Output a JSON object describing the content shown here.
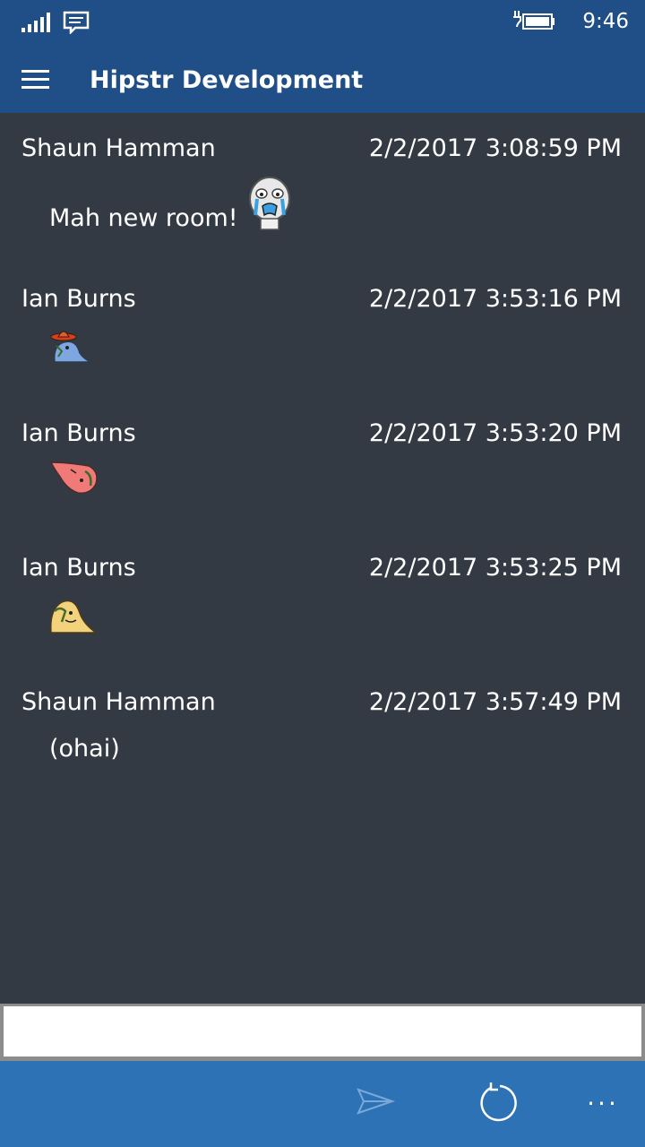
{
  "status_bar": {
    "time": "9:46",
    "icons": [
      "signal-icon",
      "message-icon",
      "battery-charging-icon"
    ]
  },
  "app_bar": {
    "title": "Hipstr Development",
    "menu_icon": "hamburger-icon"
  },
  "messages": [
    {
      "sender": "Shaun Hamman",
      "timestamp": "2/2/2017 3:08:59 PM",
      "text": "Mah new room!",
      "emoticon": "crying-face-emoticon"
    },
    {
      "sender": "Ian Burns",
      "timestamp": "2/2/2017 3:53:16 PM",
      "text": "",
      "emoticon": "sombrero-emoticon"
    },
    {
      "sender": "Ian Burns",
      "timestamp": "2/2/2017 3:53:20 PM",
      "text": "",
      "emoticon": "red-blob-emoticon"
    },
    {
      "sender": "Ian Burns",
      "timestamp": "2/2/2017 3:53:25 PM",
      "text": "",
      "emoticon": "yellow-blob-emoticon"
    },
    {
      "sender": "Shaun Hamman",
      "timestamp": "2/2/2017 3:57:49 PM",
      "text": "(ohai)",
      "emoticon": ""
    }
  ],
  "composer": {
    "value": "",
    "placeholder": ""
  },
  "command_bar": {
    "send_icon": "send-icon",
    "refresh_icon": "refresh-icon",
    "more_label": "..."
  },
  "colors": {
    "header": "#1f4f86",
    "background": "#343a44",
    "command_bar": "#2e72b6"
  }
}
